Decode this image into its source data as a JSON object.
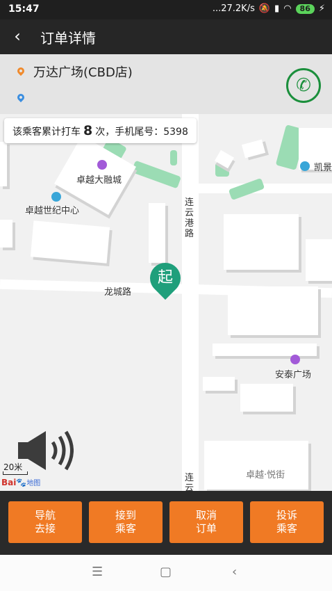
{
  "status": {
    "time": "15:47",
    "speed": "...27.2K/s",
    "battery": "86"
  },
  "header": {
    "title": "订单详情"
  },
  "route": {
    "origin": "万达广场(CBD店)",
    "destination": ""
  },
  "info_bar": {
    "prefix": "该乘客累计打车",
    "count": "8",
    "suffix": "次，手机尾号：5398"
  },
  "map": {
    "pois": [
      "卓越大融城",
      "卓越世纪中心",
      "凯景",
      "安泰广场",
      "卓越·悦街"
    ],
    "roads": [
      "龙城路",
      "连云港路",
      "连云"
    ],
    "start_marker": "起",
    "scale": "20米",
    "logo": "Bai",
    "logo_sub": "地图"
  },
  "actions": [
    {
      "label": "导航去接"
    },
    {
      "label": "接到乘客"
    },
    {
      "label": "取消订单"
    },
    {
      "label": "投诉乘客"
    }
  ],
  "icons": {
    "back": "chevron-left-icon",
    "phone": "phone-icon",
    "volume": "speaker-icon"
  },
  "colors": {
    "accent": "#f07a24",
    "header": "#262626",
    "start_pin": "#1f9f7b",
    "phone": "#1b8f3c"
  }
}
